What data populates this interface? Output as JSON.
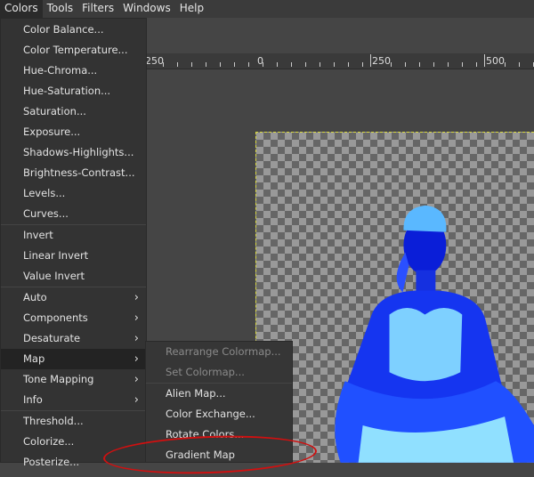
{
  "menubar": [
    "Colors",
    "Tools",
    "Filters",
    "Windows",
    "Help"
  ],
  "colors_menu": {
    "groups": [
      [
        "Color Balance...",
        "Color Temperature...",
        "Hue-Chroma...",
        "Hue-Saturation...",
        "Saturation...",
        "Exposure...",
        "Shadows-Highlights...",
        "Brightness-Contrast...",
        "Levels...",
        "Curves..."
      ],
      [
        "Invert",
        "Linear Invert",
        "Value Invert"
      ],
      [
        "Auto",
        "Components",
        "Desaturate",
        "Map",
        "Tone Mapping",
        "Info"
      ],
      [
        "Threshold...",
        "Colorize...",
        "Posterize..."
      ]
    ]
  },
  "map_submenu": {
    "disabled": [
      "Rearrange Colormap...",
      "Set Colormap..."
    ],
    "items": [
      "Alien Map...",
      "Color Exchange...",
      "Rotate Colors...",
      "Gradient Map"
    ]
  },
  "ruler": {
    "labels": [
      "250",
      "0",
      "250",
      "500"
    ]
  },
  "colors": {
    "highlight": "#d01010",
    "selection": "#dada3c"
  }
}
